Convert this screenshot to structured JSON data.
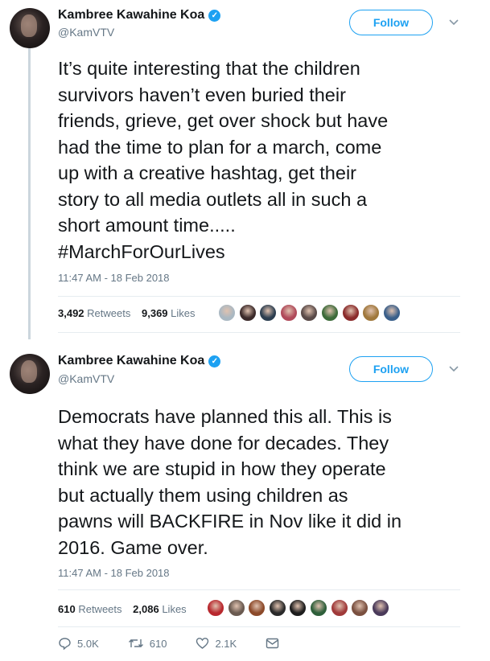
{
  "tweets": [
    {
      "author": "Kambree Kawahine Koa",
      "handle": "@KamVTV",
      "follow_label": "Follow",
      "text": "It’s quite interesting that the children\nsurvivors haven’t even buried their\nfriends, grieve, get over shock but have\nhad the time to plan for a march, come\nup with a creative hashtag, get their\nstory to all media outlets all in such a\nshort amount time.....\n#MarchForOurLives",
      "timestamp": "11:47 AM - 18 Feb 2018",
      "retweets": "3,492",
      "retweets_label": "Retweets",
      "likes": "9,369",
      "likes_label": "Likes",
      "liker_colors": [
        "#aab8c2",
        "#3b2a2a",
        "#2c3e50",
        "#b04a5a",
        "#5a4a48",
        "#3d6b3a",
        "#8a2b2b",
        "#a0783c",
        "#3a5f8a"
      ]
    },
    {
      "author": "Kambree Kawahine Koa",
      "handle": "@KamVTV",
      "follow_label": "Follow",
      "text": "Democrats have planned this all. This is\nwhat they have done for decades. They\nthink we are stupid in how they operate\nbut actually them using children as\npawns will BACKFIRE in Nov like it did in\n2016. Game over.",
      "timestamp": "11:47 AM - 18 Feb 2018",
      "retweets": "610",
      "retweets_label": "Retweets",
      "likes": "2,086",
      "likes_label": "Likes",
      "liker_colors": [
        "#b8282e",
        "#6a5a50",
        "#8c4a2a",
        "#2a2a2a",
        "#1d1d1d",
        "#2e5f3a",
        "#a03a3a",
        "#7a5040",
        "#4a3a5a"
      ]
    }
  ],
  "actions": {
    "replies": "5.0K",
    "retweets": "610",
    "likes": "2.1K"
  },
  "colors": {
    "accent": "#1da1f2",
    "text": "#14171a",
    "muted": "#657786",
    "divider": "#e6ecf0"
  }
}
